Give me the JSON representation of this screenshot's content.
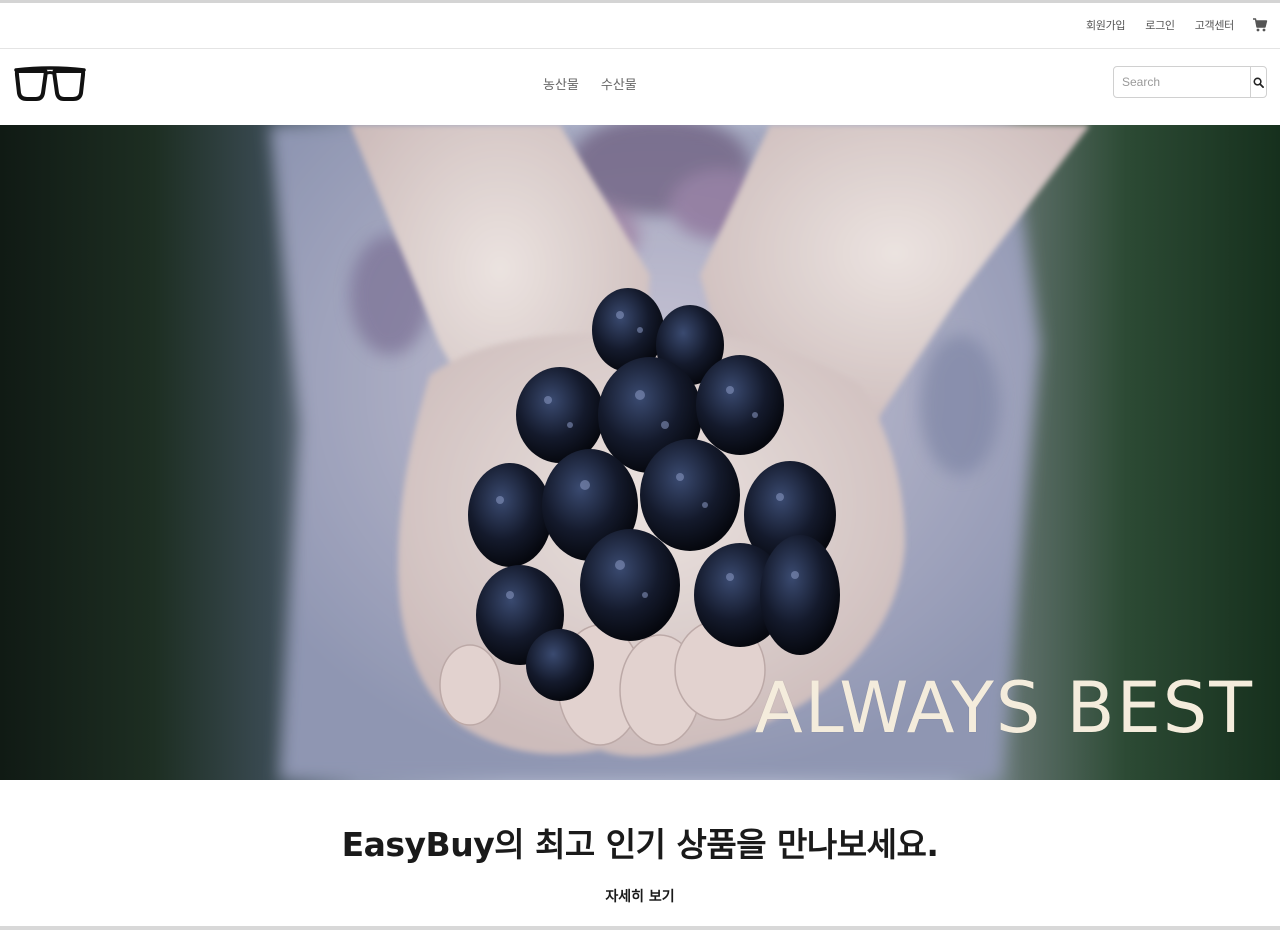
{
  "util_bar": {
    "links": [
      "회원가입",
      "로그인",
      "고객센터"
    ],
    "cart_icon": "cart-icon"
  },
  "header": {
    "logo_icon": "glasses-logo-icon",
    "nav": [
      "농산물",
      "수산물"
    ],
    "search": {
      "placeholder": "Search",
      "value": "",
      "button_icon": "search-icon"
    }
  },
  "hero": {
    "image": "hands-holding-blackberries",
    "caption": "ALWAYS BEST"
  },
  "promo": {
    "title": "EasyBuy의 최고 인기 상품을 만나보세요.",
    "link": "자세히 보기"
  },
  "colors": {
    "caption": "#f4ecdc",
    "text": "#1a1a1a",
    "nav_text": "#666666"
  }
}
